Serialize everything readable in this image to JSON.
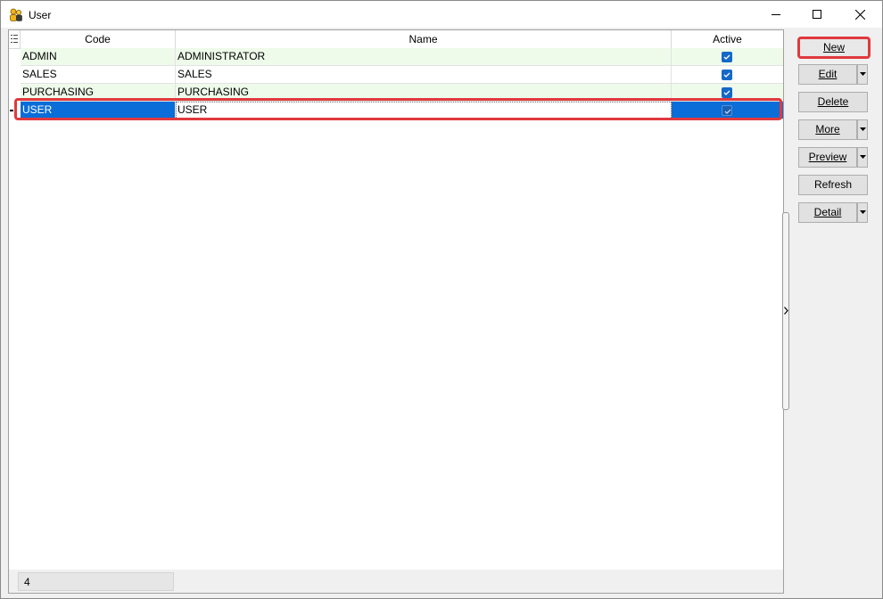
{
  "window": {
    "title": "User"
  },
  "grid": {
    "columns": {
      "code": "Code",
      "name": "Name",
      "active": "Active"
    },
    "rows": [
      {
        "code": "ADMIN",
        "name": "ADMINISTRATOR",
        "active": true
      },
      {
        "code": "SALES",
        "name": "SALES",
        "active": true
      },
      {
        "code": "PURCHASING",
        "name": "PURCHASING",
        "active": true
      },
      {
        "code": "USER",
        "name": "USER",
        "active": true,
        "selected": true
      }
    ],
    "record_count": "4"
  },
  "actions": {
    "new": "New",
    "edit": "Edit",
    "delete": "Delete",
    "more": "More",
    "preview": "Preview",
    "refresh": "Refresh",
    "detail": "Detail"
  },
  "colors": {
    "selection": "#0a6dd8",
    "alt_row": "#eefbea",
    "highlight": "#e0393e",
    "checkbox": "#1468c8"
  }
}
